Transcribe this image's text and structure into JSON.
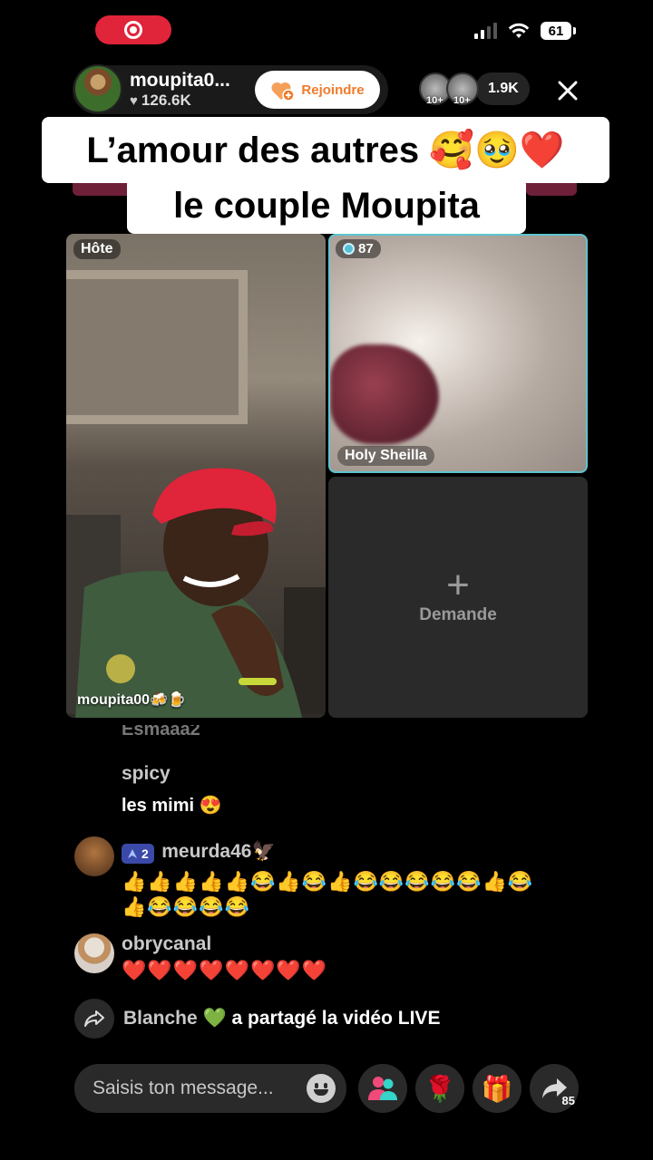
{
  "status_bar": {
    "battery": "61"
  },
  "header": {
    "host_name": "moupita0...",
    "host_likes": "126.6K",
    "join_label": "Rejoindre",
    "viewer_badges": [
      "10+",
      "10+"
    ],
    "viewer_count": "1.9K"
  },
  "caption": {
    "line1": "L’amour des autres 🥰🥹❤️",
    "line2": "le couple Moupita"
  },
  "grid": {
    "host_badge": "Hôte",
    "host_name": "moupita00🍻🍺",
    "guest_score": "87",
    "guest_name": "Holy Sheilla",
    "request_label": "Demande"
  },
  "comments": {
    "cut_user": "Esmaaa2",
    "c1_user": "spicy",
    "c1_text": "les mimi 😍",
    "c2_level": "2",
    "c2_user": "meurda46🦅",
    "c2_line1": "👍👍👍👍👍😂👍😂👍😂😂😂😂😂👍😂",
    "c2_line2": "👍😂😂😂😂",
    "c3_user": "obrycanal",
    "c3_text": "❤️❤️❤️❤️❤️❤️❤️❤️",
    "share_user": "Blanche 💚",
    "share_text": "a partagé la vidéo LIVE"
  },
  "bottom_bar": {
    "message_placeholder": "Saisis ton message...",
    "rose": "🌹",
    "gift": "🎁",
    "share_count": "85"
  },
  "colors": {
    "background": "#000000",
    "live_pill": "#e0243a",
    "join_text": "#f07b2a",
    "guest_border": "#5dc4d0",
    "level_badge": "#3b4aa8"
  }
}
